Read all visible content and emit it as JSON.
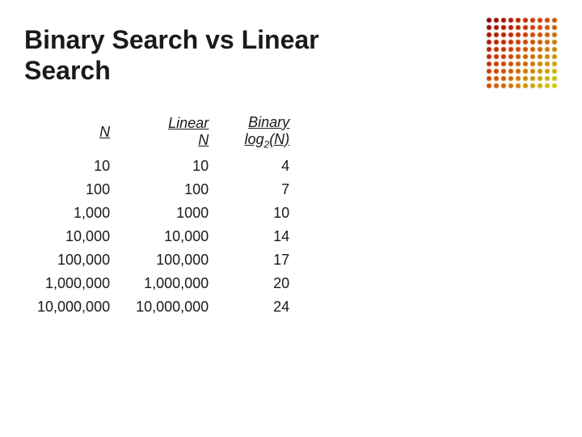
{
  "title": {
    "line1": "Binary Search vs Linear",
    "line2": "Search"
  },
  "table": {
    "headers": {
      "n": "N",
      "linear_label": "Linear",
      "linear_n": "N",
      "binary_label": "Binary",
      "binary_n": "log₂(N)"
    },
    "rows": [
      {
        "n": "10",
        "linear": "10",
        "binary": "4"
      },
      {
        "n": "100",
        "linear": "100",
        "binary": "7"
      },
      {
        "n": "1,000",
        "linear": "1000",
        "binary": "10"
      },
      {
        "n": "10,000",
        "linear": "10,000",
        "binary": "14"
      },
      {
        "n": "100,000",
        "linear": "100,000",
        "binary": "17"
      },
      {
        "n": "1,000,000",
        "linear": "1,000,000",
        "binary": "20"
      },
      {
        "n": "10,000,000",
        "linear": "10,000,000",
        "binary": "24"
      }
    ]
  }
}
